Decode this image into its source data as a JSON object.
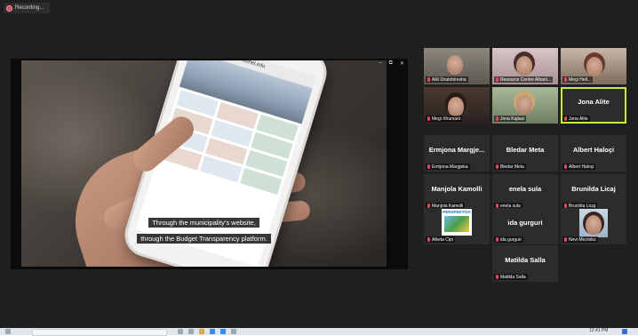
{
  "recording": {
    "label": "Recording..."
  },
  "share": {
    "site_url": "fushel.info",
    "subtitle_line1": "Through the municipality’s website,",
    "subtitle_line2": "through the Budget Transparency platform.",
    "controls": [
      "–",
      "⧉",
      "✕"
    ]
  },
  "participants": [
    {
      "name": "Alili Shatobiresha",
      "type": "video",
      "palette": "warm"
    },
    {
      "name": "Resource Centre Albani...",
      "type": "video",
      "palette": "pink"
    },
    {
      "name": "Megi Hell...",
      "type": "video",
      "palette": "office"
    },
    {
      "name": "Megi Xhumani",
      "type": "video",
      "palette": "dark"
    },
    {
      "name": "Jona Kajtazi",
      "type": "video",
      "palette": "light"
    },
    {
      "name": "Jona Alite",
      "type": "name",
      "display": "Jona Alite",
      "active": true
    },
    {
      "name": "Ermjona Margjeka",
      "type": "name",
      "display": "Ermjona  Margje..."
    },
    {
      "name": "Bledar Meta",
      "type": "name",
      "display": "Bledar Meta"
    },
    {
      "name": "Albert Haloçi",
      "type": "name",
      "display": "Albert Haloçi"
    },
    {
      "name": "Manjola Kamolli",
      "type": "name",
      "display": "Manjola Kamolli"
    },
    {
      "name": "enela sula",
      "type": "name",
      "display": "enela sula"
    },
    {
      "name": "Brunilda Licaj",
      "type": "name",
      "display": "Brunilda Licaj"
    },
    {
      "name": "Alketa Cipi",
      "type": "logo",
      "logo_text": "PERSPEKTIVA"
    },
    {
      "name": "ida gurguri",
      "type": "name",
      "display": "ida gurguri"
    },
    {
      "name": "Nevi Mezreku",
      "type": "video",
      "palette": "portrait"
    },
    {
      "name": "Matilda Salla",
      "type": "name",
      "display": "Matilda Salla"
    }
  ],
  "taskbar": {
    "time": "12:41 PM"
  },
  "colors": {
    "active_speaker": "#c8f03b",
    "muted": "#e34a5a",
    "background": "#1f1f1f"
  }
}
